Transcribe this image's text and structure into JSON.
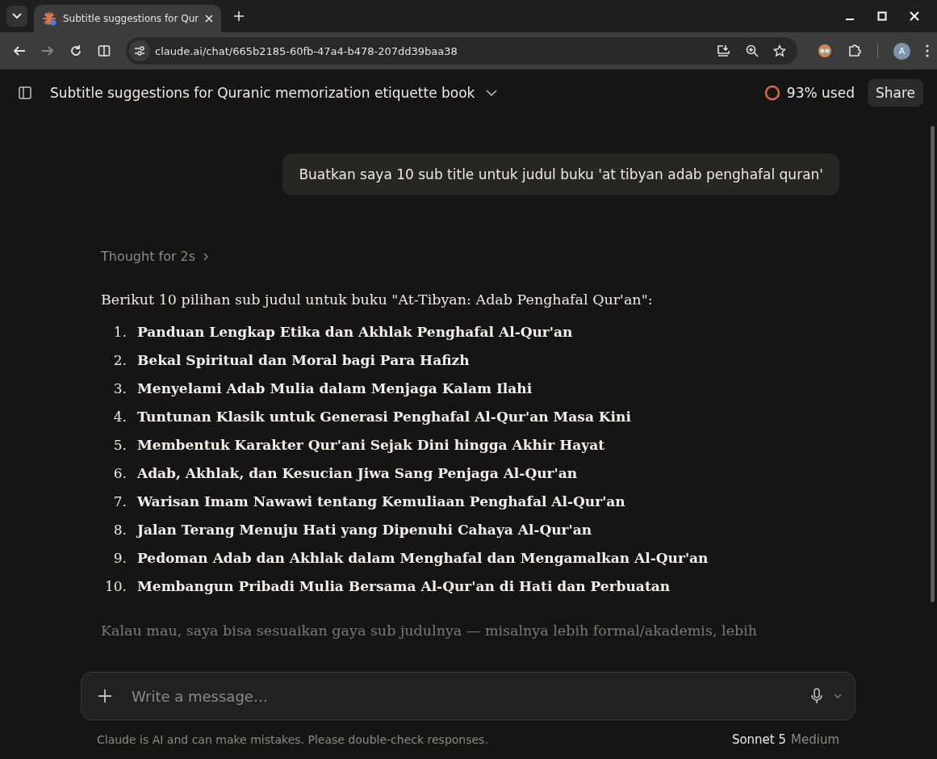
{
  "browser": {
    "tab": {
      "title": "Subtitle suggestions for Qur",
      "selected": true
    },
    "address": "claude.ai/chat/665b2185-60fb-47a4-b478-207dd39baa38",
    "avatar": "A"
  },
  "header": {
    "title": "Subtitle suggestions for Quranic memorization etiquette book",
    "usage": "93% used",
    "share": "Share"
  },
  "user_message": "Buatkan saya 10 sub title untuk judul buku 'at tibyan adab penghafal quran'",
  "thought": "Thought for 2s",
  "reply": {
    "intro": "Berikut 10 pilihan sub judul untuk buku \"At-Tibyan: Adab Penghafal Qur'an\":",
    "items": [
      {
        "number": "1.",
        "text": "Panduan Lengkap Etika dan Akhlak Penghafal Al-Qur'an"
      },
      {
        "number": "2.",
        "text": "Bekal Spiritual dan Moral bagi Para Hafizh"
      },
      {
        "number": "3.",
        "text": "Menyelami Adab Mulia dalam Menjaga Kalam Ilahi"
      },
      {
        "number": "4.",
        "text": "Tuntunan Klasik untuk Generasi Penghafal Al-Qur'an Masa Kini"
      },
      {
        "number": "5.",
        "text": "Membentuk Karakter Qur'ani Sejak Dini hingga Akhir Hayat"
      },
      {
        "number": "6.",
        "text": "Adab, Akhlak, dan Kesucian Jiwa Sang Penjaga Al-Qur'an"
      },
      {
        "number": "7.",
        "text": "Warisan Imam Nawawi tentang Kemuliaan Penghafal Al-Qur'an"
      },
      {
        "number": "8.",
        "text": "Jalan Terang Menuju Hati yang Dipenuhi Cahaya Al-Qur'an"
      },
      {
        "number": "9.",
        "text": "Pedoman Adab dan Akhlak dalam Menghafal dan Mengamalkan Al-Qur'an"
      },
      {
        "number": "10.",
        "text": "Membangun Pribadi Mulia Bersama Al-Qur'an di Hati dan Perbuatan"
      }
    ],
    "outro": "Kalau mau, saya bisa sesuaikan gaya sub judulnya — misalnya lebih formal/akademis, lebih"
  },
  "composer": {
    "placeholder": "Write a message…"
  },
  "footer": {
    "disclaimer": "Claude is AI and can make mistakes. Please double-check responses.",
    "model": "Sonnet 5",
    "effort": "Medium"
  }
}
